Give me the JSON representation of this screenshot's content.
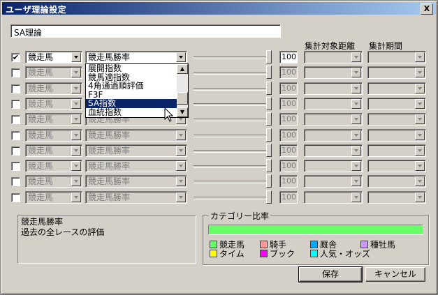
{
  "window": {
    "title": "ユーザ理論設定",
    "close_label": "X"
  },
  "theory_name": "SA理論",
  "column_headers": {
    "distance": "集計対象距離",
    "period": "集計期間"
  },
  "rows": [
    {
      "checked": "✔",
      "category": "競走馬",
      "factor": "競走馬勝率",
      "value": "100",
      "enabled": true
    },
    {
      "checked": "",
      "category": "競走馬",
      "factor": "展開指数",
      "value": "100",
      "enabled": false
    },
    {
      "checked": "",
      "category": "競走馬",
      "factor": "競走馬勝率",
      "value": "100",
      "enabled": false
    },
    {
      "checked": "",
      "category": "競走馬",
      "factor": "競走馬勝率",
      "value": "100",
      "enabled": false
    },
    {
      "checked": "",
      "category": "競走馬",
      "factor": "競走馬勝率",
      "value": "100",
      "enabled": false
    },
    {
      "checked": "",
      "category": "競走馬",
      "factor": "競走馬勝率",
      "value": "100",
      "enabled": false
    },
    {
      "checked": "",
      "category": "競走馬",
      "factor": "競走馬勝率",
      "value": "100",
      "enabled": false
    },
    {
      "checked": "",
      "category": "競走馬",
      "factor": "競走馬勝率",
      "value": "100",
      "enabled": false
    },
    {
      "checked": "",
      "category": "競走馬",
      "factor": "競走馬勝率",
      "value": "100",
      "enabled": false
    },
    {
      "checked": "",
      "category": "競走馬",
      "factor": "競走馬勝率",
      "value": "100",
      "enabled": false
    }
  ],
  "dropdown_options": [
    "展開指数",
    "競馬適指数",
    "4角通過順評価",
    "F3F",
    "SA指数",
    "血統指数"
  ],
  "dropdown_selected": "SA指数",
  "description": {
    "title": "競走馬勝率",
    "text": "過去の全レースの評価"
  },
  "category_group": {
    "label": "カテゴリー比率",
    "bar_color": "#66ff66",
    "legend": [
      {
        "label": "競走馬",
        "color": "#66ff66"
      },
      {
        "label": "騎手",
        "color": "#ff9999"
      },
      {
        "label": "厩舎",
        "color": "#00aaff"
      },
      {
        "label": "種牡馬",
        "color": "#cc99ff"
      },
      {
        "label": "タイム",
        "color": "#ffff00"
      },
      {
        "label": "ブック",
        "color": "#ff00ff"
      },
      {
        "label": "人気・オッズ",
        "color": "#00ffff"
      }
    ]
  },
  "buttons": {
    "save": "保存",
    "cancel": "キャンセル"
  }
}
